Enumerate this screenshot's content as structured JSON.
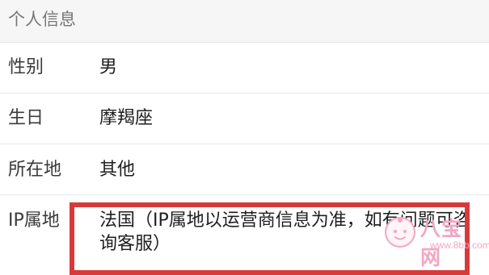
{
  "section": {
    "title": "个人信息"
  },
  "rows": [
    {
      "label": "性别",
      "value": "男"
    },
    {
      "label": "生日",
      "value": "摩羯座"
    },
    {
      "label": "所在地",
      "value": "其他"
    },
    {
      "label": "IP属地",
      "value": "法国（IP属地以运营商信息为准，如有问题可咨询客服）"
    }
  ],
  "watermark": {
    "brand": "八宝网",
    "url": "www.8bb.com",
    "icon": "baby-face-logo-icon"
  },
  "colors": {
    "highlight": "#d63a3a",
    "watermark": "#f2a7c2",
    "section_bg": "#f6f6f6"
  }
}
